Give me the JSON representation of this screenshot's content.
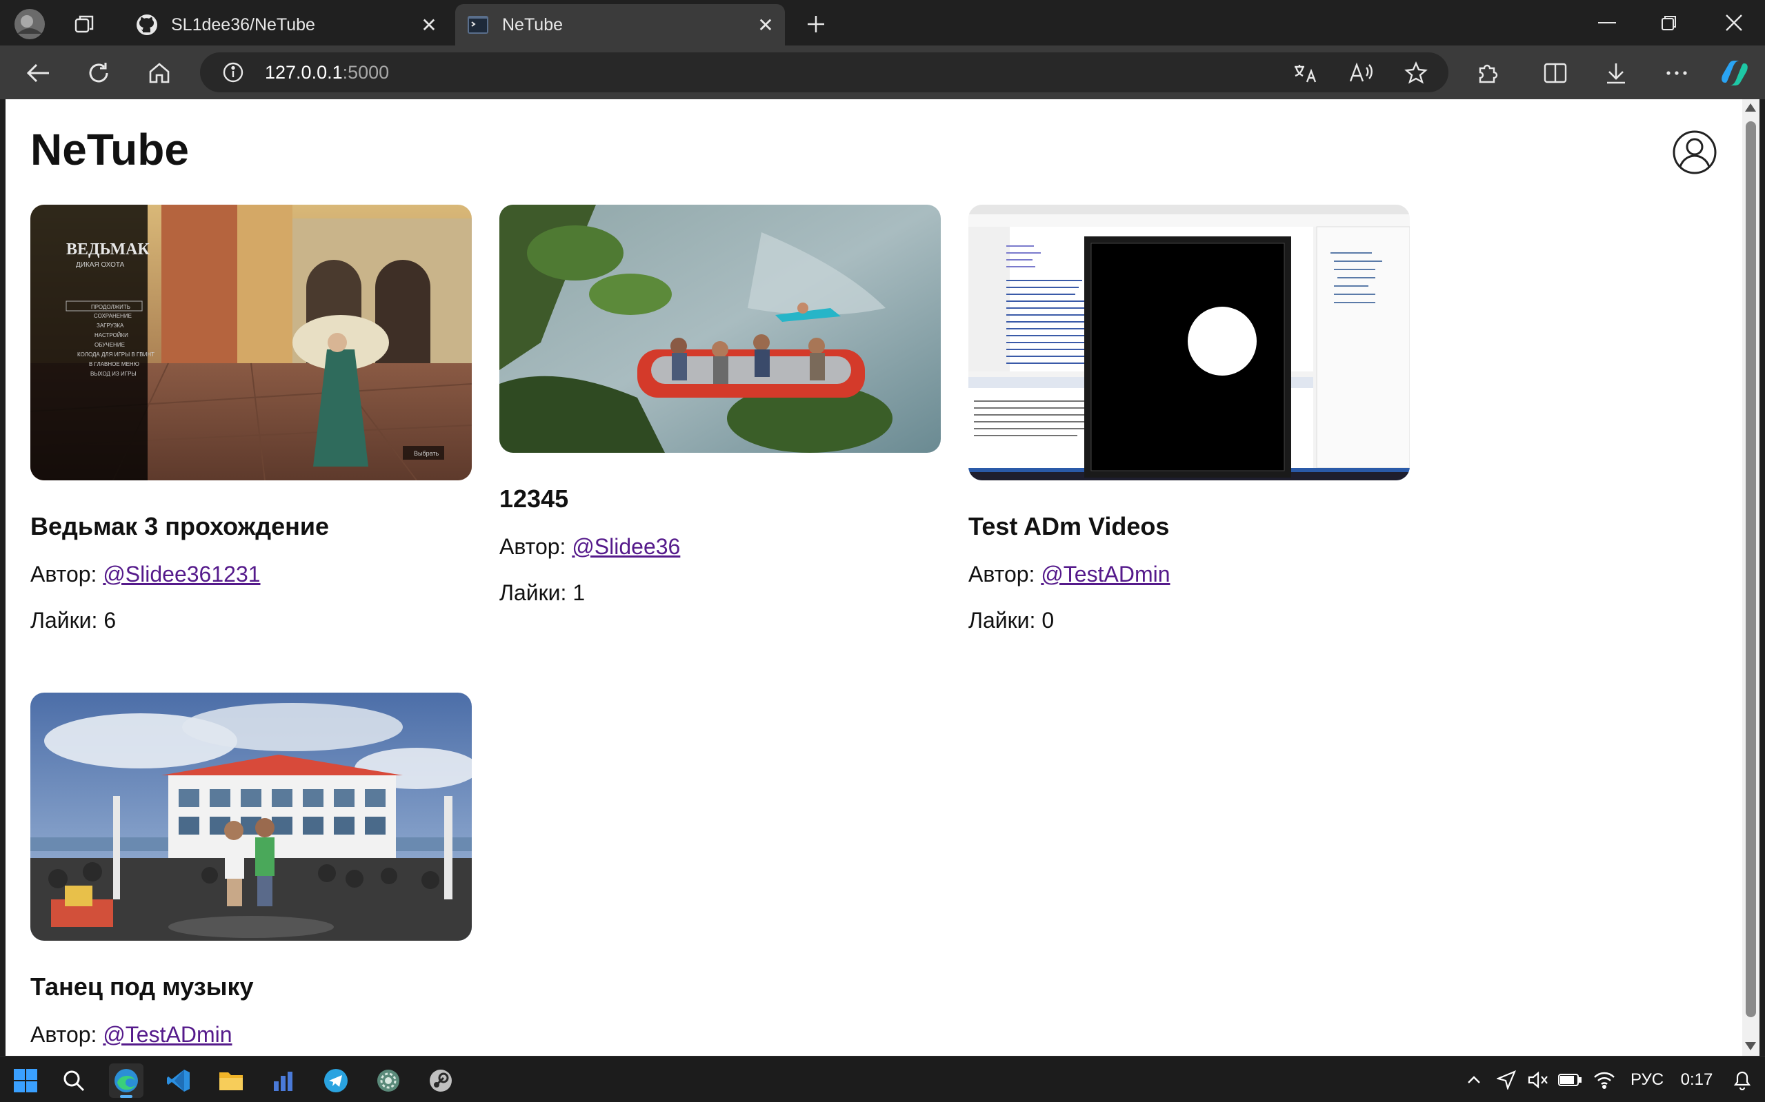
{
  "browser": {
    "tabs": [
      {
        "title": "SL1dee36/NeTube",
        "active": false
      },
      {
        "title": "NeTube",
        "active": true
      }
    ],
    "address": {
      "host": "127.0.0.1",
      "port": ":5000"
    }
  },
  "page": {
    "site_title": "NeTube",
    "author_label": "Автор: ",
    "likes_label": "Лайки: ",
    "videos": [
      {
        "title": "Ведьмак 3 прохождение",
        "author": "@Slidee361231",
        "likes": "6"
      },
      {
        "title": "12345",
        "author": "@Slidee36",
        "likes": "1"
      },
      {
        "title": "Test ADm Videos",
        "author": "@TestADmin",
        "likes": "0"
      },
      {
        "title": "Танец под музыку",
        "author": "@TestADmin"
      }
    ],
    "thumb_text": {
      "witcher_logo_line1": "ВЕДЬМАК",
      "witcher_logo_line2": "ДИКАЯ ОХОТА",
      "witcher_menu": [
        "ПРОДОЛЖИТЬ",
        "СОХРАНЕНИЕ",
        "ЗАГРУЗКА",
        "НАСТРОЙКИ",
        "ОБУЧЕНИЕ",
        "КОЛОДА ДЛЯ ИГРЫ В ГВИНТ",
        "В ГЛАВНОЕ МЕНЮ",
        "ВЫХОД ИЗ ИГРЫ"
      ],
      "witcher_select": "Выбрать"
    }
  },
  "taskbar": {
    "language": "РУС",
    "time": "0:17"
  },
  "colors": {
    "link": "#551a8b",
    "taskbar_accent": "#58b0f5"
  }
}
